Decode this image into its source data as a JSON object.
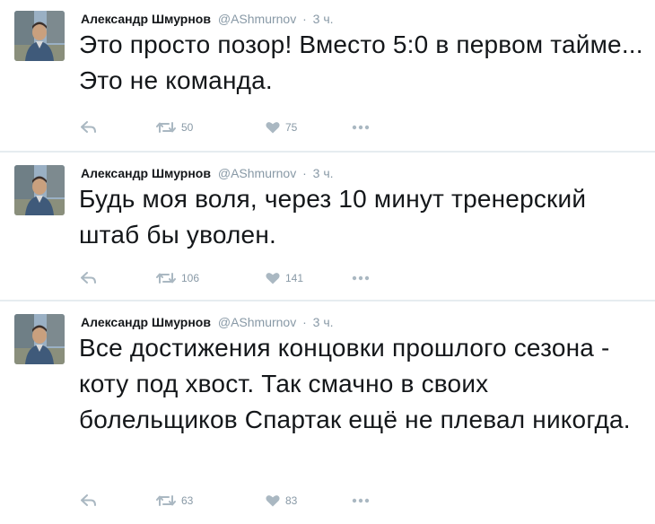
{
  "tweets": [
    {
      "author_name": "Александр Шмурнов",
      "handle": "@AShmurnov",
      "separator": "·",
      "time": "3 ч.",
      "text": "Это просто позор! Вместо 5:0 в первом тайме... Это не команда.",
      "retweets": "50",
      "likes": "75"
    },
    {
      "author_name": "Александр Шмурнов",
      "handle": "@AShmurnov",
      "separator": "·",
      "time": "3 ч.",
      "text": "Будь моя воля, через 10 минут тренерский штаб бы уволен.",
      "retweets": "106",
      "likes": "141"
    },
    {
      "author_name": "Александр Шмурнов",
      "handle": "@AShmurnov",
      "separator": "·",
      "time": "3 ч.",
      "text": "Все достижения концовки прошлого сезона - коту под хвост. Так смачно в своих болельщиков Спартак ещё не плевал никогда.",
      "retweets": "63",
      "likes": "83"
    }
  ],
  "icons": {
    "reply": "reply-icon",
    "retweet": "retweet-icon",
    "like": "heart-icon",
    "more": "more-icon"
  },
  "colors": {
    "text": "#14171a",
    "muted": "#8899a6",
    "icon": "#aab8c2",
    "divider": "#e6ecf0"
  }
}
